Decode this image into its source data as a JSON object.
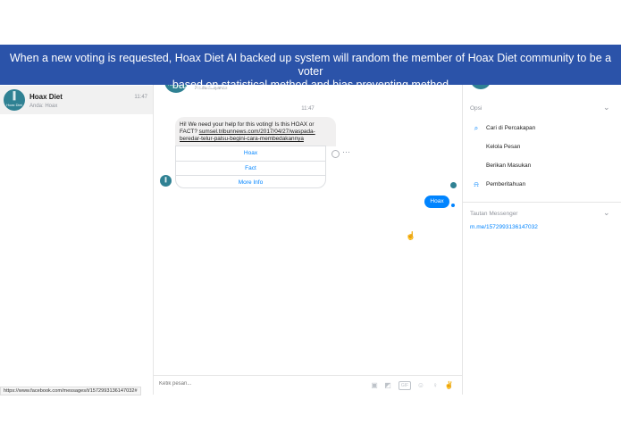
{
  "banner": {
    "line1": "When a new voting is requested, Hoax Diet AI backed up system will random the member of Hoax Diet community to be a voter",
    "line2": "based on statistical method and bias preventing method"
  },
  "conversation": {
    "name": "Hoax Diet",
    "snippet": "Anda: Hoax",
    "time": "11:47",
    "avatar_text": "Hoax Diet"
  },
  "chat": {
    "avatar_text": "Hoax Diet",
    "subtitle": "Produk/Layanan",
    "timestamp": "11:47",
    "message_text": "Hi! We need your help for this voting! Is this HOAX or FACT?",
    "message_link": "sumsel.tribunnews.com/2017/04/27/waspada-beredar-telur-palsu-begini-cara-membedakannya",
    "quick_replies": [
      "Hoax",
      "Fact",
      "More Info"
    ],
    "sent_message": "Hoax",
    "composer_placeholder": "Ketik pesan..."
  },
  "right_panel": {
    "avatar_text": "Hoax Diet",
    "options_title": "Opsi",
    "options": [
      {
        "label": "Cari di Percakapan",
        "icon": "search-icon"
      },
      {
        "label": "Kelola Pesan",
        "icon": ""
      },
      {
        "label": "Berikan Masukan",
        "icon": ""
      },
      {
        "label": "Pemberitahuan",
        "icon": "bell-icon"
      }
    ],
    "link_title": "Tautan Messenger",
    "link_url": "m.me/1572993136147032"
  },
  "status_bar": {
    "url": "https://www.facebook.com/messages/t/1572993136147032#"
  },
  "colors": {
    "banner": "#2b53a9",
    "messenger_blue": "#0084ff",
    "avatar_teal": "#2f8193"
  }
}
